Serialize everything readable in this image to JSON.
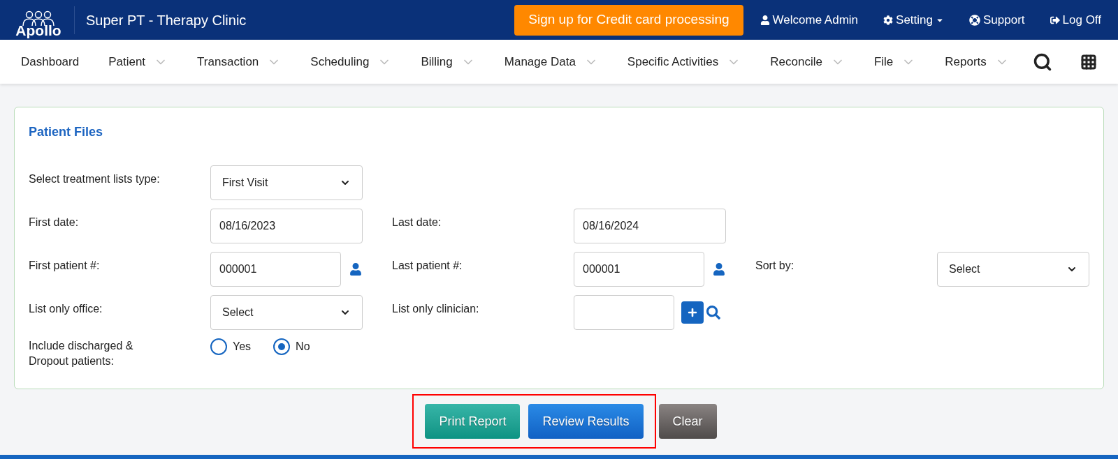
{
  "header": {
    "logo": "Apollo",
    "clinic": "Super PT - Therapy Clinic",
    "promo_button": "Sign up for Credit card processing",
    "links": [
      {
        "label": "Welcome Admin",
        "kind": "user",
        "dropdown": false
      },
      {
        "label": "Setting",
        "kind": "gear",
        "dropdown": true
      },
      {
        "label": "Support",
        "kind": "support",
        "dropdown": false
      },
      {
        "label": "Log Off",
        "kind": "logout",
        "dropdown": false
      }
    ]
  },
  "nav": [
    {
      "label": "Dashboard",
      "dropdown": false
    },
    {
      "label": "Patient",
      "dropdown": true
    },
    {
      "label": "Transaction",
      "dropdown": true
    },
    {
      "label": "Scheduling",
      "dropdown": true
    },
    {
      "label": "Billing",
      "dropdown": true
    },
    {
      "label": "Manage Data",
      "dropdown": true
    },
    {
      "label": "Specific Activities",
      "dropdown": true
    },
    {
      "label": "Reconcile",
      "dropdown": true
    },
    {
      "label": "File",
      "dropdown": true
    },
    {
      "label": "Reports",
      "dropdown": true
    }
  ],
  "panel": {
    "title": "Patient Files",
    "rows": [
      [
        {
          "label": "Select treatment lists type:",
          "kind": "select",
          "value": "First Visit"
        }
      ],
      [
        {
          "label": "First date:",
          "kind": "input",
          "value": "08/16/2023"
        },
        {
          "label": "Last date:",
          "kind": "input",
          "value": "08/16/2024"
        }
      ],
      [
        {
          "label": "First patient #:",
          "kind": "input",
          "value": "000001",
          "addon": {
            "kind": "person"
          }
        },
        {
          "label": "Last patient #:",
          "kind": "input",
          "value": "000001",
          "addon": {
            "kind": "person"
          }
        },
        {
          "label": "Sort by:",
          "kind": "select",
          "value": "Select"
        }
      ],
      [
        {
          "label": "List only office:",
          "kind": "select",
          "value": "Select"
        },
        {
          "label": "List only clinician:",
          "kind": "input",
          "addon": {
            "kind": "addsearch"
          }
        }
      ],
      [
        {
          "label": "Include discharged & Dropout patients:",
          "kind": "radio",
          "options": [
            {
              "label": "Yes",
              "selected": false
            },
            {
              "label": "No",
              "selected": true
            }
          ]
        }
      ]
    ]
  },
  "buttons": [
    {
      "label": "Print Report",
      "kind": "print",
      "highlighted": true
    },
    {
      "label": "Review Results",
      "kind": "review",
      "highlighted": true
    },
    {
      "label": "Clear",
      "kind": "clear",
      "highlighted": false
    }
  ]
}
